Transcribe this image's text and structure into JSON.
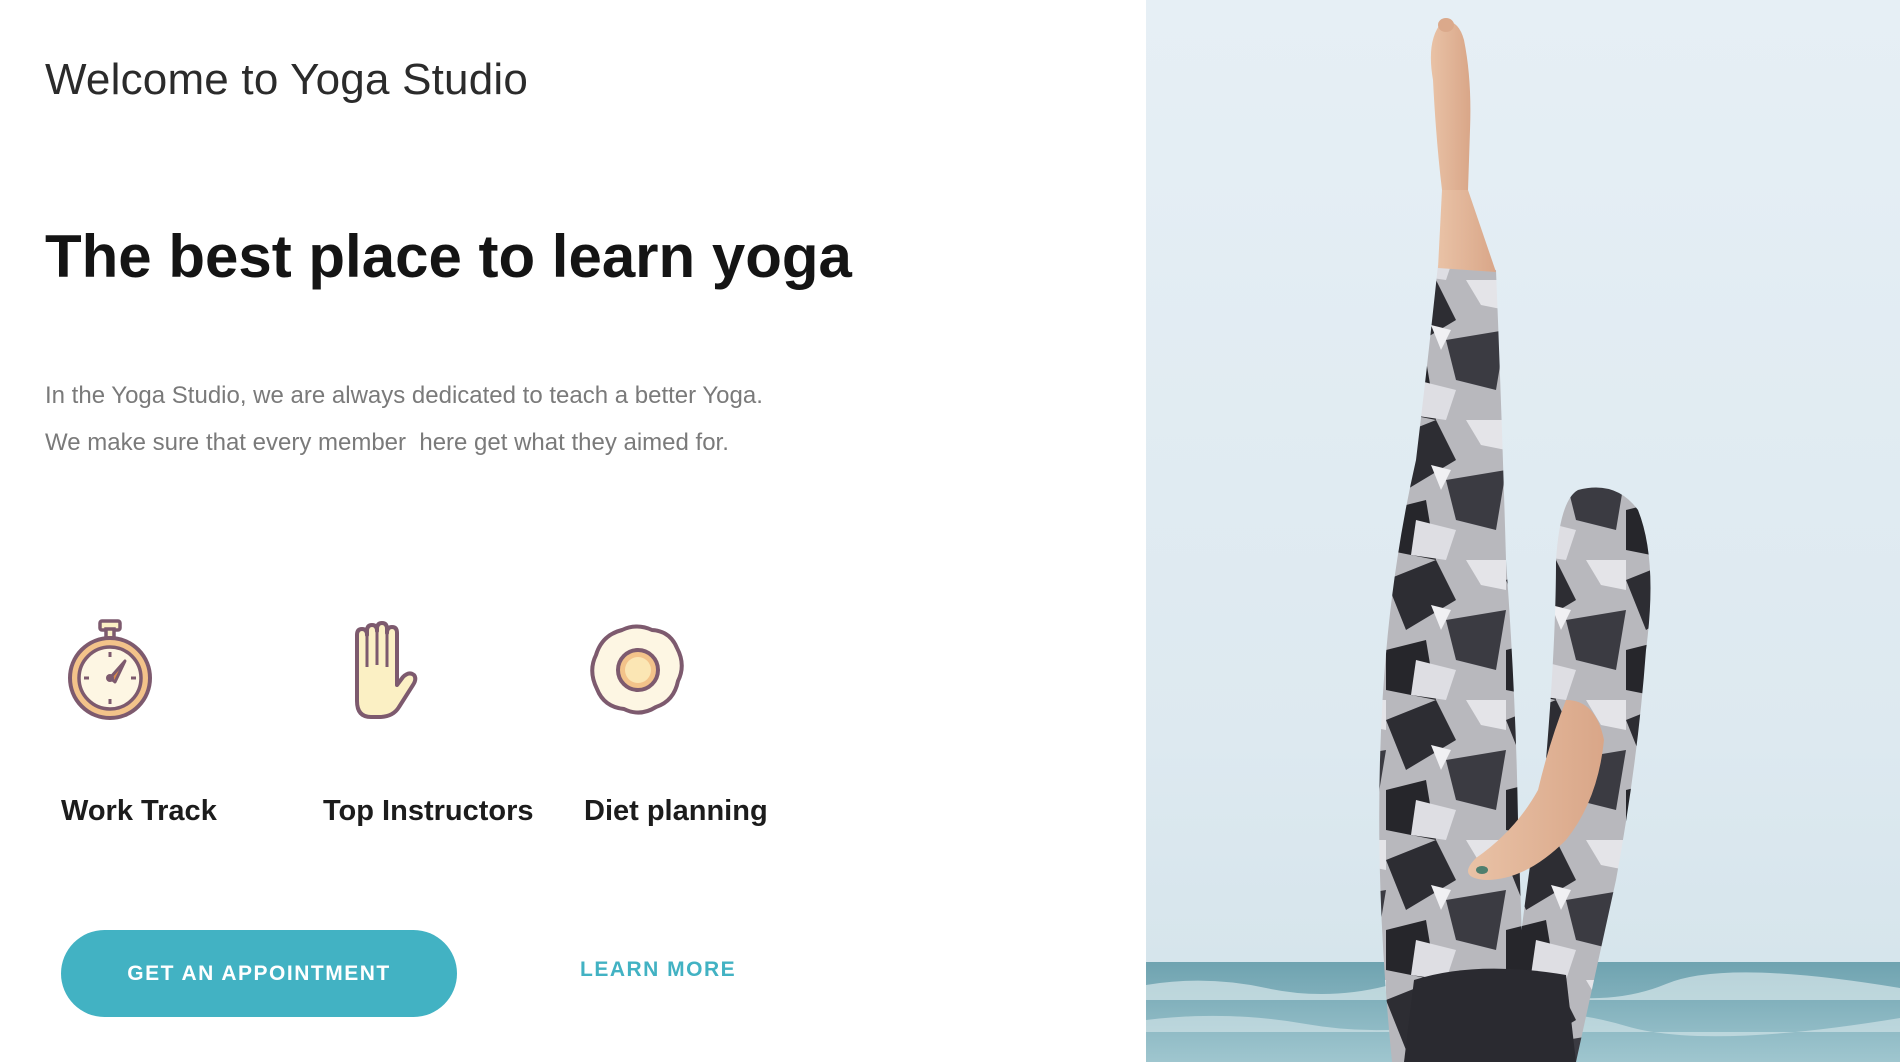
{
  "header": {
    "welcome": "Welcome to Yoga Studio"
  },
  "hero": {
    "headline": "The best place to learn yoga",
    "description_line1": "In the Yoga Studio, we are always dedicated to teach a better Yoga.",
    "description_line2": "We make sure that every member  here get what they aimed for."
  },
  "features": [
    {
      "label": "Work Track",
      "icon": "stopwatch-icon"
    },
    {
      "label": "Top Instructors",
      "icon": "hand-icon"
    },
    {
      "label": "Diet planning",
      "icon": "fried-egg-icon"
    }
  ],
  "actions": {
    "primary_label": "GET AN APPOINTMENT",
    "secondary_label": "LEARN MORE"
  },
  "colors": {
    "accent": "#42b2c3",
    "icon_stroke": "#7d5a6e",
    "icon_fill_cream": "#fbf0c4",
    "icon_fill_orange": "#f3c38a"
  }
}
